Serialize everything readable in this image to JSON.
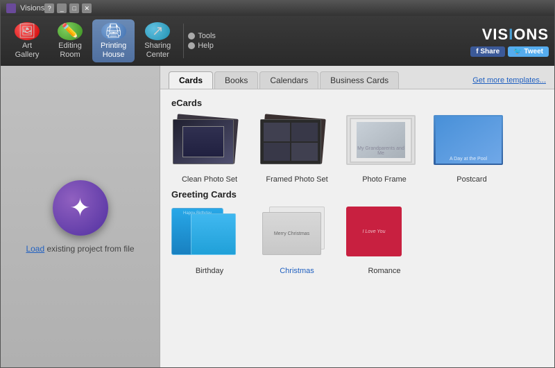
{
  "window": {
    "title": "Visions",
    "icon": "visions-icon"
  },
  "toolbar": {
    "buttons": [
      {
        "id": "art-gallery",
        "label": "Art\nGallery",
        "icon": "art-gallery-icon",
        "color": "red",
        "active": false
      },
      {
        "id": "editing-room",
        "label": "Editing\nRoom",
        "icon": "editing-room-icon",
        "color": "green",
        "active": false
      },
      {
        "id": "printing-house",
        "label": "Printing\nHouse",
        "icon": "printing-house-icon",
        "color": "blue-active",
        "active": true
      },
      {
        "id": "sharing-center",
        "label": "Sharing\nCenter",
        "icon": "sharing-center-icon",
        "color": "teal",
        "active": false
      }
    ],
    "tools_label": "Tools",
    "help_label": "Help"
  },
  "branding": {
    "logo": "VISIONS",
    "share_label": "Share",
    "tweet_label": "Tweet"
  },
  "left_panel": {
    "load_text": "Load",
    "load_rest": " existing project from file"
  },
  "tabs": {
    "items": [
      {
        "id": "cards",
        "label": "Cards",
        "active": true
      },
      {
        "id": "books",
        "label": "Books",
        "active": false
      },
      {
        "id": "calendars",
        "label": "Calendars",
        "active": false
      },
      {
        "id": "business-cards",
        "label": "Business Cards",
        "active": false
      }
    ],
    "get_more": "Get more templates..."
  },
  "sections": {
    "ecards": {
      "title": "eCards",
      "items": [
        {
          "id": "clean-photo-set",
          "label": "Clean Photo Set"
        },
        {
          "id": "framed-photo-set",
          "label": "Framed Photo Set"
        },
        {
          "id": "photo-frame",
          "label": "Photo Frame"
        },
        {
          "id": "postcard",
          "label": "Postcard"
        }
      ]
    },
    "greeting_cards": {
      "title": "Greeting Cards",
      "items": [
        {
          "id": "birthday",
          "label": "Birthday"
        },
        {
          "id": "christmas",
          "label": "Christmas",
          "link": true
        },
        {
          "id": "romance",
          "label": "Romance"
        }
      ]
    }
  }
}
